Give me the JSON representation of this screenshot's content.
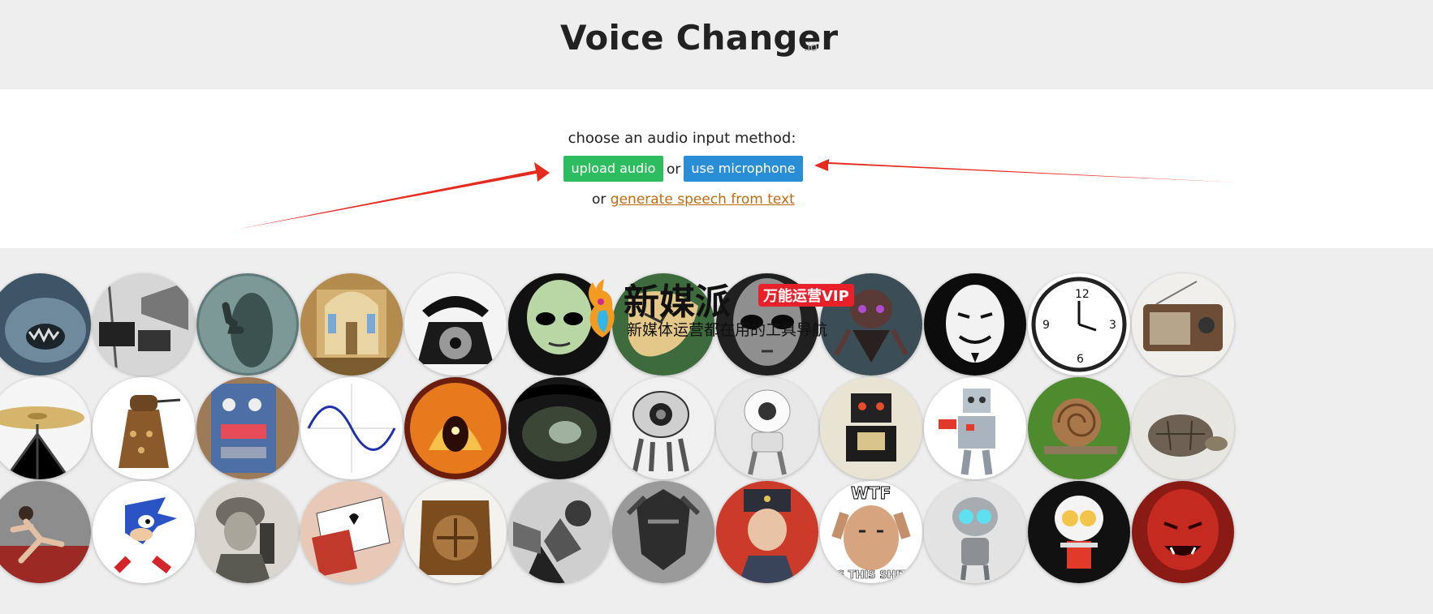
{
  "header": {
    "title": "Voice Changer",
    "title_suffix": ".io"
  },
  "input_panel": {
    "prompt": "choose an audio input method:",
    "upload_label": "upload audio",
    "or_label": "or",
    "mic_label": "use microphone",
    "or_prefix": "or",
    "tts_link": "generate speech from text"
  },
  "colors": {
    "upload": "#2dbd5e",
    "microphone": "#2a8ed6",
    "link": "#c06a10",
    "arrow": "#e52b1f"
  },
  "watermark": {
    "brand": "新媒派",
    "badge": "万能运营VIP",
    "tagline": "新媒体运营都在用的工具导航"
  },
  "voice_rows": [
    [
      "cave-monster",
      "megaphone",
      "ghost",
      "church",
      "telephone",
      "alien",
      "melting-clock",
      "grey-alien",
      "robot-insect",
      "anonymous-mask",
      "wall-clock",
      "radio"
    ],
    [
      "cymbal",
      "dalek",
      "synth-pedal",
      "sine-wave",
      "fire-demon",
      "cave",
      "robot-eye",
      "white-robot",
      "toy-robot",
      "lego-robot",
      "snail",
      "tortoise"
    ],
    [
      "sprinter",
      "sonic",
      "soldier-radio",
      "playing-cards",
      "vintage-speaker",
      "phonograph",
      "dark-knight",
      "russian-officer",
      "wtf-meme",
      "gir-robot",
      "kirobo-robot",
      "red-devil"
    ]
  ],
  "meme_text": {
    "top": "WTF",
    "bottom": "IS THIS SHIT"
  }
}
